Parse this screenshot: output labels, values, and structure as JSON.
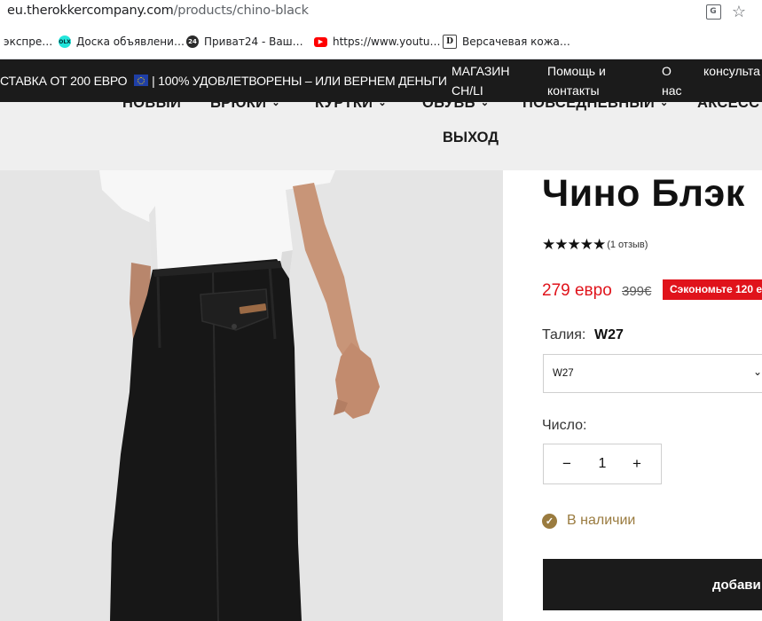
{
  "browser": {
    "url_host": "eu.therokkercompany.com",
    "url_path": "/products/chino-black",
    "bookmarks": [
      {
        "label": "экспре…"
      },
      {
        "label": "Доска объявлени…",
        "icon_text": "OLX"
      },
      {
        "label": "Приват24 - Ваш…",
        "icon_text": "24"
      },
      {
        "label": "https://www.youtu…"
      },
      {
        "label": "Версачевая кожа…",
        "icon_text": "D"
      }
    ]
  },
  "header": {
    "promo_part1": "СТАВКА ОТ 200 ЕВРО",
    "promo_part2": "100% УДОВЛЕТВОРЕНЫ – ИЛИ ВЕРНЕМ ДЕНЬГИ",
    "links": {
      "store_1": "МАГАЗИН",
      "store_2": "CH/LI",
      "help_1": "Помощь и",
      "help_2": "контакты",
      "about_1": "О",
      "about_2": "нас",
      "consult": "консульта"
    }
  },
  "nav": {
    "items": [
      "НОВЫЙ",
      "БРЮКИ",
      "КУРТКИ",
      "ОБУВЬ",
      "ПОВСЕДНЕВНЫЙ",
      "АКСЕСС"
    ],
    "exit": "ВЫХОД"
  },
  "product": {
    "title": "Чино Блэк",
    "stars": "★★★★★",
    "rating_value": 5,
    "reviews": "(1 отзыв)",
    "price": "279 евро",
    "old_price": "399€",
    "save_badge": "Сэкономьте 120 е",
    "waist_label": "Талия:",
    "waist_value": "W27",
    "select_value": "W27",
    "qty_label": "Число:",
    "qty_minus": "−",
    "qty_value": "1",
    "qty_plus": "+",
    "stock": "В наличии",
    "add_button": "добави"
  },
  "colors": {
    "accent_red": "#e0131b",
    "header_dark": "#1b1b1b",
    "stock_gold": "#9a7b3f"
  }
}
